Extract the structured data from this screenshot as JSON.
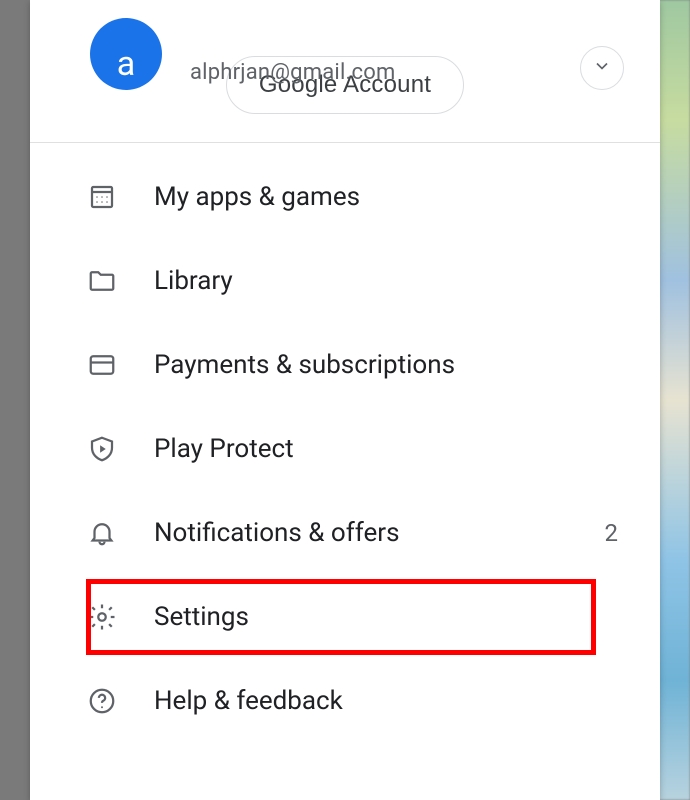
{
  "account": {
    "avatar_initial": "a",
    "email": "alphrjan@gmail.com",
    "manage_label": "Google Account"
  },
  "menu": {
    "items": [
      {
        "label": "My apps & games",
        "icon": "apps-icon"
      },
      {
        "label": "Library",
        "icon": "folder-icon"
      },
      {
        "label": "Payments & subscriptions",
        "icon": "card-icon"
      },
      {
        "label": "Play Protect",
        "icon": "shield-icon"
      },
      {
        "label": "Notifications & offers",
        "icon": "bell-icon",
        "badge": "2"
      },
      {
        "label": "Settings",
        "icon": "gear-icon",
        "highlighted": true
      },
      {
        "label": "Help & feedback",
        "icon": "help-icon"
      }
    ]
  }
}
